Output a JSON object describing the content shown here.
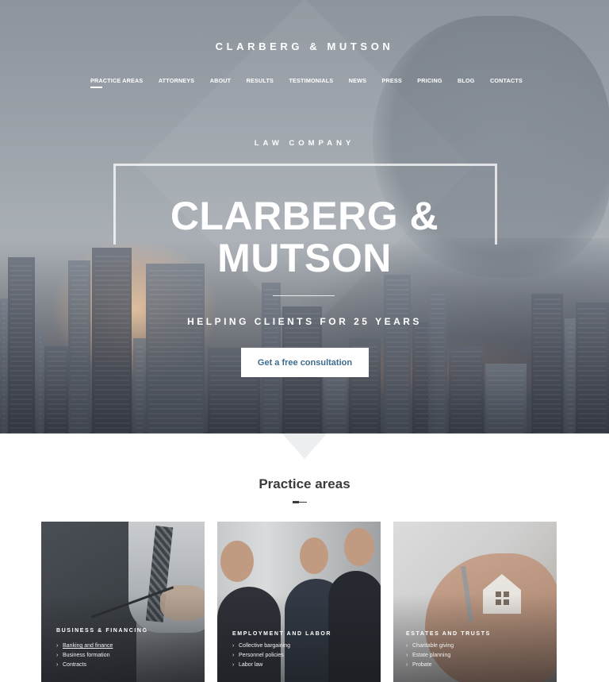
{
  "header": {
    "brand": "CLARBERG & MUTSON",
    "nav": [
      {
        "label": "PRACTICE AREAS",
        "active": true
      },
      {
        "label": "ATTORNEYS"
      },
      {
        "label": "ABOUT"
      },
      {
        "label": "RESULTS"
      },
      {
        "label": "TESTIMONIALS"
      },
      {
        "label": "NEWS"
      },
      {
        "label": "PRESS"
      },
      {
        "label": "PRICING"
      },
      {
        "label": "BLOG"
      },
      {
        "label": "CONTACTS"
      }
    ]
  },
  "hero": {
    "kicker": "LAW COMPANY",
    "title_line1": "CLARBERG &",
    "title_line2": "MUTSON",
    "tagline": "HELPING CLIENTS FOR 25 YEARS",
    "cta_label": "Get a free consultation"
  },
  "practice": {
    "title": "Practice areas",
    "cards": [
      {
        "title": "BUSINESS & FINANCING",
        "items": [
          "Banking and finance",
          "Business formation",
          "Contracts"
        ]
      },
      {
        "title": "EMPLOYMENT AND LABOR",
        "items": [
          "Collective bargaining",
          "Personnel policies",
          "Labor law"
        ]
      },
      {
        "title": "ESTATES AND TRUSTS",
        "items": [
          "Charitable giving",
          "Estate planning",
          "Probate"
        ]
      }
    ]
  },
  "colors": {
    "accent": "#3d6c8e",
    "heading": "#3b3b3b",
    "white": "#ffffff"
  }
}
